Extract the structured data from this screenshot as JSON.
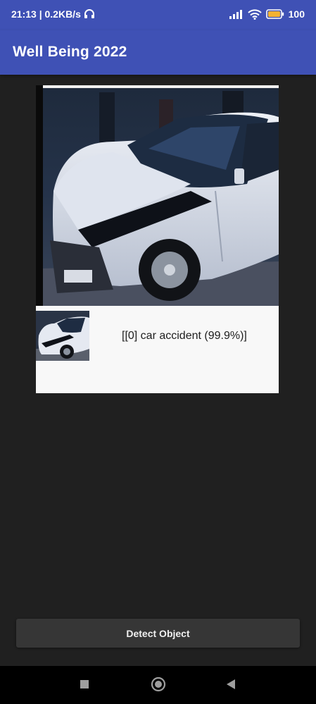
{
  "status_bar": {
    "time_speed": "21:13 | 0.2KB/s",
    "battery": "100"
  },
  "app_bar": {
    "title": "Well Being 2022"
  },
  "result": {
    "label": "[[0] car accident (99.9%)]"
  },
  "actions": {
    "detect_label": "Detect Object"
  },
  "colors": {
    "primary": "#3f51b5",
    "background": "#202020",
    "button": "#363636"
  },
  "icons": {
    "status": [
      "headset-icon",
      "signal-icon",
      "wifi-icon",
      "battery-icon"
    ],
    "nav": [
      "recent-apps-icon",
      "home-icon",
      "back-icon"
    ]
  }
}
